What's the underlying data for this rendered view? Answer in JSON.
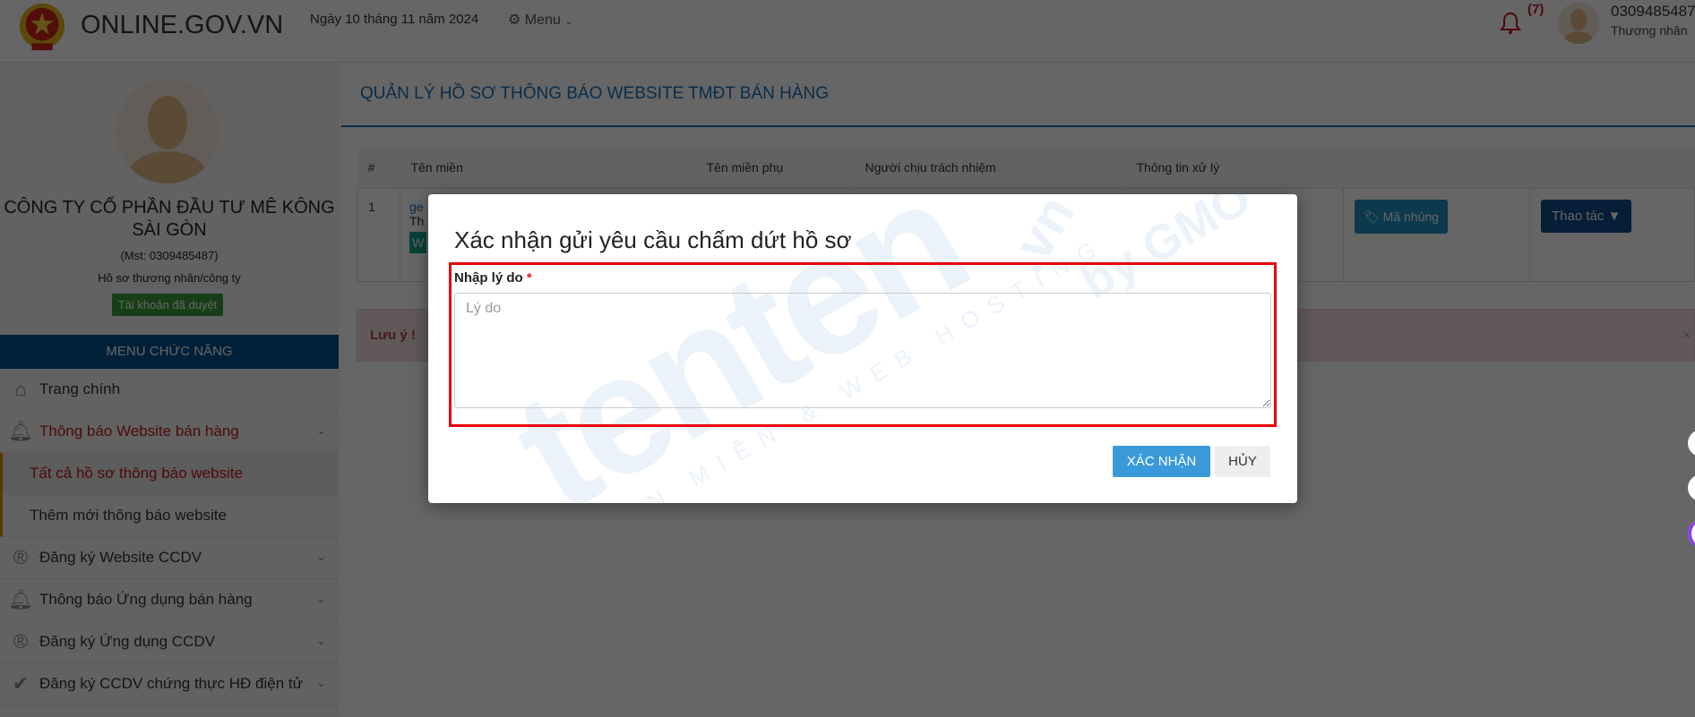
{
  "header": {
    "site_name": "ONLINE.GOV.VN",
    "date": "Ngày 10 tháng 11 năm 2024",
    "menu_label": "Menu",
    "notification_count": "(7)",
    "user_id": "0309485487",
    "user_role": "Thương nhân"
  },
  "sidebar": {
    "company_name": "CÔNG TY CỔ PHẦN ĐẦU TƯ MÊ KÔNG SÀI GÒN",
    "mst": "(Mst: 0309485487)",
    "profile_link": "Hồ sơ thương nhân/công ty",
    "account_status": "Tài khoản đã duyệt",
    "menu_title": "MENU CHỨC NĂNG",
    "items": [
      {
        "label": "Trang chính",
        "icon": "home-icon"
      },
      {
        "label": "Thông báo Website bán hàng",
        "icon": "bell-icon",
        "active": true
      },
      {
        "label": "Tất cả hồ sơ thông báo website",
        "sub": true,
        "active": true
      },
      {
        "label": "Thêm mới thông báo website",
        "sub": true
      },
      {
        "label": "Đăng ký Website CCDV",
        "icon": "registered-icon"
      },
      {
        "label": "Thông báo Ứng dụng bán hàng",
        "icon": "bell-outline-icon"
      },
      {
        "label": "Đăng ký Ứng dụng CCDV",
        "icon": "registered-icon"
      },
      {
        "label": "Đăng ký CCDV chứng thực HĐ điện tử",
        "icon": "check-circle-icon"
      }
    ]
  },
  "main": {
    "title": "QUẢN LÝ HỒ SƠ THÔNG BÁO WEBSITE TMĐT BÁN HÀNG",
    "table": {
      "headers": [
        "#",
        "Tên miền",
        "Tên miền phụ",
        "Người chịu trách nhiệm",
        "Thông tin xử lý"
      ],
      "rows": [
        {
          "index": "1",
          "domain_fragment": "ge",
          "status_fragment": "Th",
          "button_fragment": "W",
          "embed_label": "Mã nhúng",
          "action_label": "Thao tác"
        }
      ]
    },
    "alert": "Lưu ý !",
    "alert_close": "×"
  },
  "modal": {
    "title": "Xác nhận gửi yêu cầu chấm dứt hồ sơ",
    "field_label": "Nhập lý do",
    "required_mark": "*",
    "placeholder": "Lý do",
    "value": "",
    "confirm_label": "XÁC NHẬN",
    "cancel_label": "HỦY",
    "watermark": {
      "brand": "tenten",
      "suffix": ".vn",
      "by": "by GMO",
      "tagline": "TÊN MIỀN & WEB HOSTING"
    }
  },
  "colors": {
    "accent": "#1b6fb5",
    "highlight_border": "#e8000b",
    "confirm": "#3a9ad9",
    "active_menu": "#c0161b"
  }
}
